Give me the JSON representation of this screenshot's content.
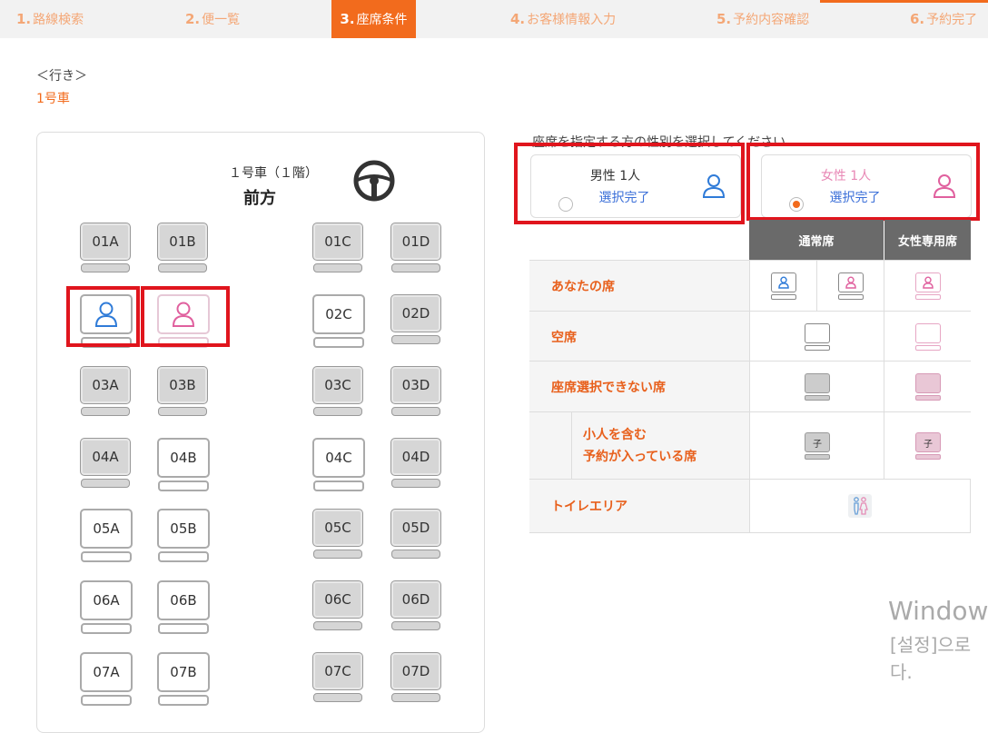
{
  "steps": [
    {
      "num": "1.",
      "label": "路線検索"
    },
    {
      "num": "2.",
      "label": "便一覧"
    },
    {
      "num": "3.",
      "label": "座席条件"
    },
    {
      "num": "4.",
      "label": "お客様情報入力"
    },
    {
      "num": "5.",
      "label": "予約内容確認"
    },
    {
      "num": "6.",
      "label": "予約完了"
    }
  ],
  "trip": {
    "direction": "＜行き＞",
    "car": "1号車"
  },
  "bus": {
    "floor_label": "１号車（１階）",
    "front_label": "前方",
    "rows": [
      [
        "01A",
        "01B",
        "01C",
        "01D"
      ],
      [
        "",
        "",
        "02C",
        "02D"
      ],
      [
        "03A",
        "03B",
        "03C",
        "03D"
      ],
      [
        "04A",
        "04B",
        "04C",
        "04D"
      ],
      [
        "05A",
        "05B",
        "05C",
        "05D"
      ],
      [
        "06A",
        "06B",
        "06C",
        "06D"
      ],
      [
        "07A",
        "07B",
        "07C",
        "07D"
      ]
    ]
  },
  "gender": {
    "instruction": "座席を指定する方の性別を選択してください",
    "male": {
      "title": "男性 1人",
      "status": "選択完了"
    },
    "female": {
      "title": "女性 1人",
      "status": "選択完了"
    }
  },
  "legend": {
    "headers": {
      "normal": "通常席",
      "women_only": "女性専用席"
    },
    "rows": {
      "yours": "あなたの席",
      "empty": "空席",
      "unavailable": "座席選択できない席",
      "child_line1": "小人を含む",
      "child_line2": "予約が入っている席",
      "toilet": "トイレエリア"
    },
    "child_mark": "子"
  },
  "watermark": {
    "line1": "Window",
    "line2": "[설정]으로",
    "line3": "다."
  },
  "colors": {
    "accent": "#f26b1d",
    "male": "#2f7bd8",
    "female": "#e0609e",
    "highlight": "#e0151d"
  }
}
